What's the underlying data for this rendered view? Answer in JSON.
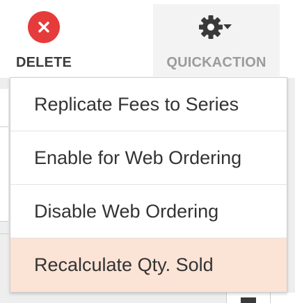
{
  "toolbar": {
    "delete_label": "DELETE",
    "quickaction_label": "QUICKACTION",
    "delete_icon": "close-circle-icon",
    "quickaction_icon": "gear-dropdown-icon",
    "delete_color": "#e63b3b"
  },
  "menu": {
    "items": [
      {
        "label": "Replicate Fees to Series",
        "highlighted": false
      },
      {
        "label": "Enable for Web Ordering",
        "highlighted": false
      },
      {
        "label": "Disable Web Ordering",
        "highlighted": false
      },
      {
        "label": "Recalculate Qty. Sold",
        "highlighted": true
      }
    ],
    "highlight_color": "#fbe3d6"
  },
  "background": {
    "calendar_icon": "calendar-icon"
  }
}
